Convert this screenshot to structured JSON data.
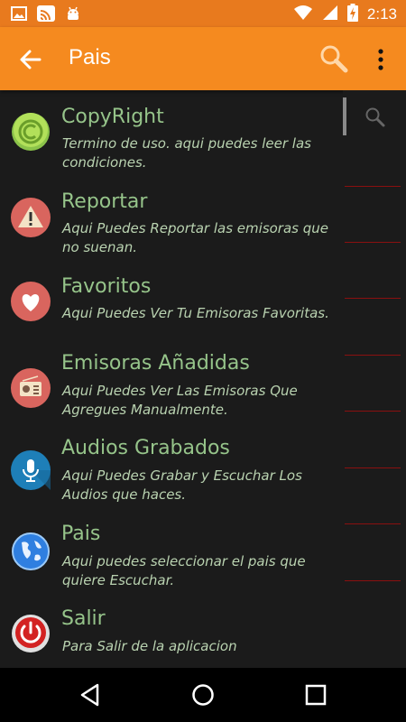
{
  "status_bar": {
    "time": "2:13",
    "icons": [
      "image-icon",
      "cast-icon",
      "android-icon",
      "wifi-icon",
      "signal-icon",
      "battery-charging-icon"
    ]
  },
  "app_bar": {
    "title": "Pais",
    "back_icon": "arrow-back-icon",
    "search_icon": "search-icon",
    "more_icon": "more-vert-icon"
  },
  "menu": {
    "items": [
      {
        "title": "CopyRight",
        "description": "Termino de uso. aqui puedes leer las condiciones.",
        "icon": "copyright-icon"
      },
      {
        "title": "Reportar",
        "description": "Aqui Puedes Reportar las emisoras que no suenan.",
        "icon": "warning-icon"
      },
      {
        "title": "Favoritos",
        "description": "Aqui Puedes Ver Tu Emisoras Favoritas.",
        "icon": "heart-icon"
      },
      {
        "title": "Emisoras Añadidas",
        "description": "Aqui Puedes Ver Las Emisoras Que Agregues Manualmente.",
        "icon": "radio-icon"
      },
      {
        "title": "Audios Grabados",
        "description": "Aqui Puedes Grabar y Escuchar Los Audios que haces.",
        "icon": "microphone-icon"
      },
      {
        "title": "Pais",
        "description": "Aqui puedes seleccionar el pais que quiere Escuchar.",
        "icon": "globe-icon"
      },
      {
        "title": "Salir",
        "description": "Para Salir de la aplicacion",
        "icon": "power-icon"
      }
    ]
  },
  "side_panel": {
    "search_icon": "search-icon"
  },
  "nav_bar": {
    "icons": [
      "back-triangle-icon",
      "home-circle-icon",
      "recents-square-icon"
    ]
  },
  "colors": {
    "status_bar": "#e87a1e",
    "app_bar": "#f58a1f",
    "background": "#1b1b1b",
    "title_text": "#96c48a",
    "desc_text": "#b9d2b0",
    "divider": "#8a1010"
  }
}
